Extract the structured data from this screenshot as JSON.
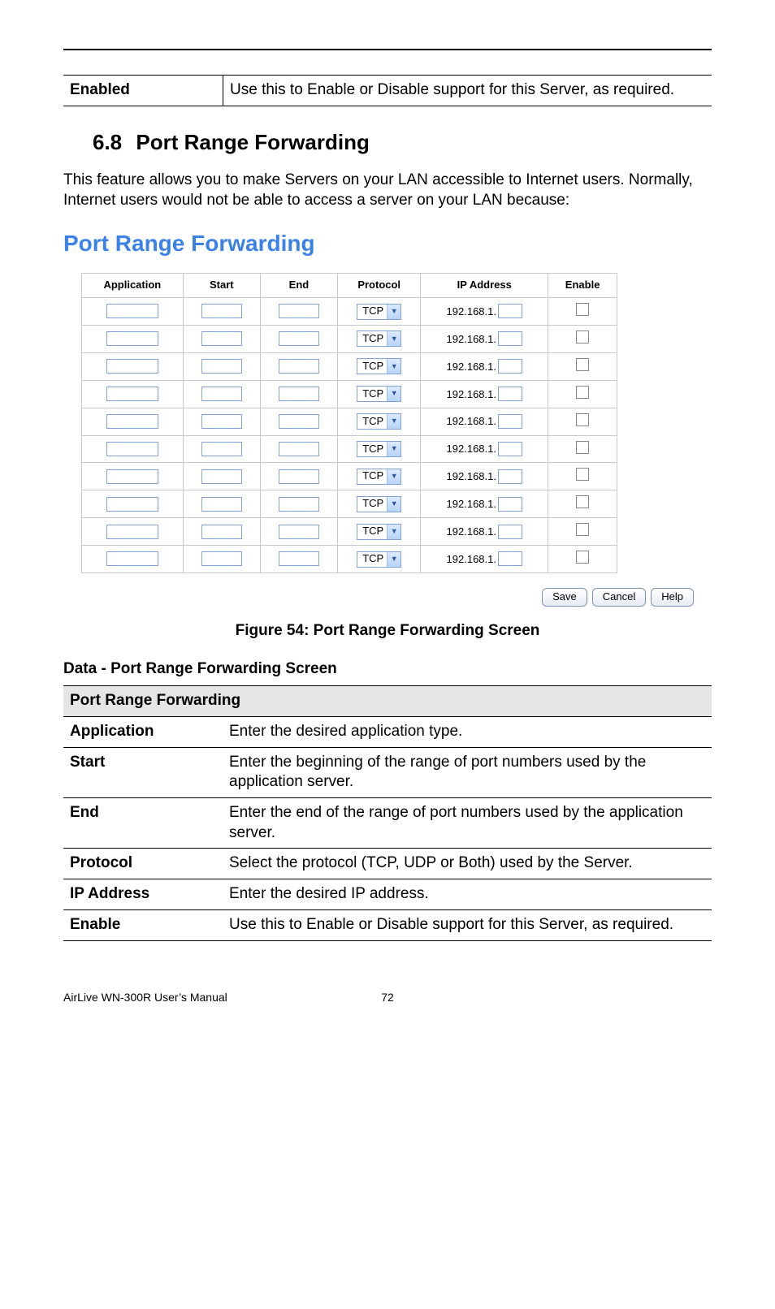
{
  "top_row": {
    "label": "Enabled",
    "desc": "Use this to Enable or Disable support for this Server, as required."
  },
  "section": {
    "number": "6.8",
    "title": "Port Range Forwarding"
  },
  "intro": "This feature allows you to make Servers on your LAN accessible to Internet users. Normally, Internet users would not be able to access a server on your LAN because:",
  "panel_title": "Port Range Forwarding",
  "grid": {
    "headers": [
      "Application",
      "Start",
      "End",
      "Protocol",
      "IP Address",
      "Enable"
    ],
    "protocol_value": "TCP",
    "ip_prefix": "192.168.1.",
    "row_count": 10
  },
  "buttons": {
    "save": "Save",
    "cancel": "Cancel",
    "help": "Help"
  },
  "figure_caption": "Figure 54: Port Range Forwarding Screen",
  "data_heading": "Data - Port Range Forwarding Screen",
  "def_section": "Port Range Forwarding",
  "defs": [
    {
      "k": "Application",
      "v": "Enter the desired application type."
    },
    {
      "k": "Start",
      "v": "Enter the beginning of the range of port numbers used by the application server."
    },
    {
      "k": "End",
      "v": "Enter the end of the range of port numbers used by the application server."
    },
    {
      "k": "Protocol",
      "v": "Select the protocol (TCP, UDP or Both) used by the Server."
    },
    {
      "k": "IP Address",
      "v": "Enter the desired IP address."
    },
    {
      "k": "Enable",
      "v": "Use this to Enable or Disable support for this Server, as required."
    }
  ],
  "footer": {
    "brand": "AirLive WN-300R User’s Manual",
    "page": "72"
  }
}
